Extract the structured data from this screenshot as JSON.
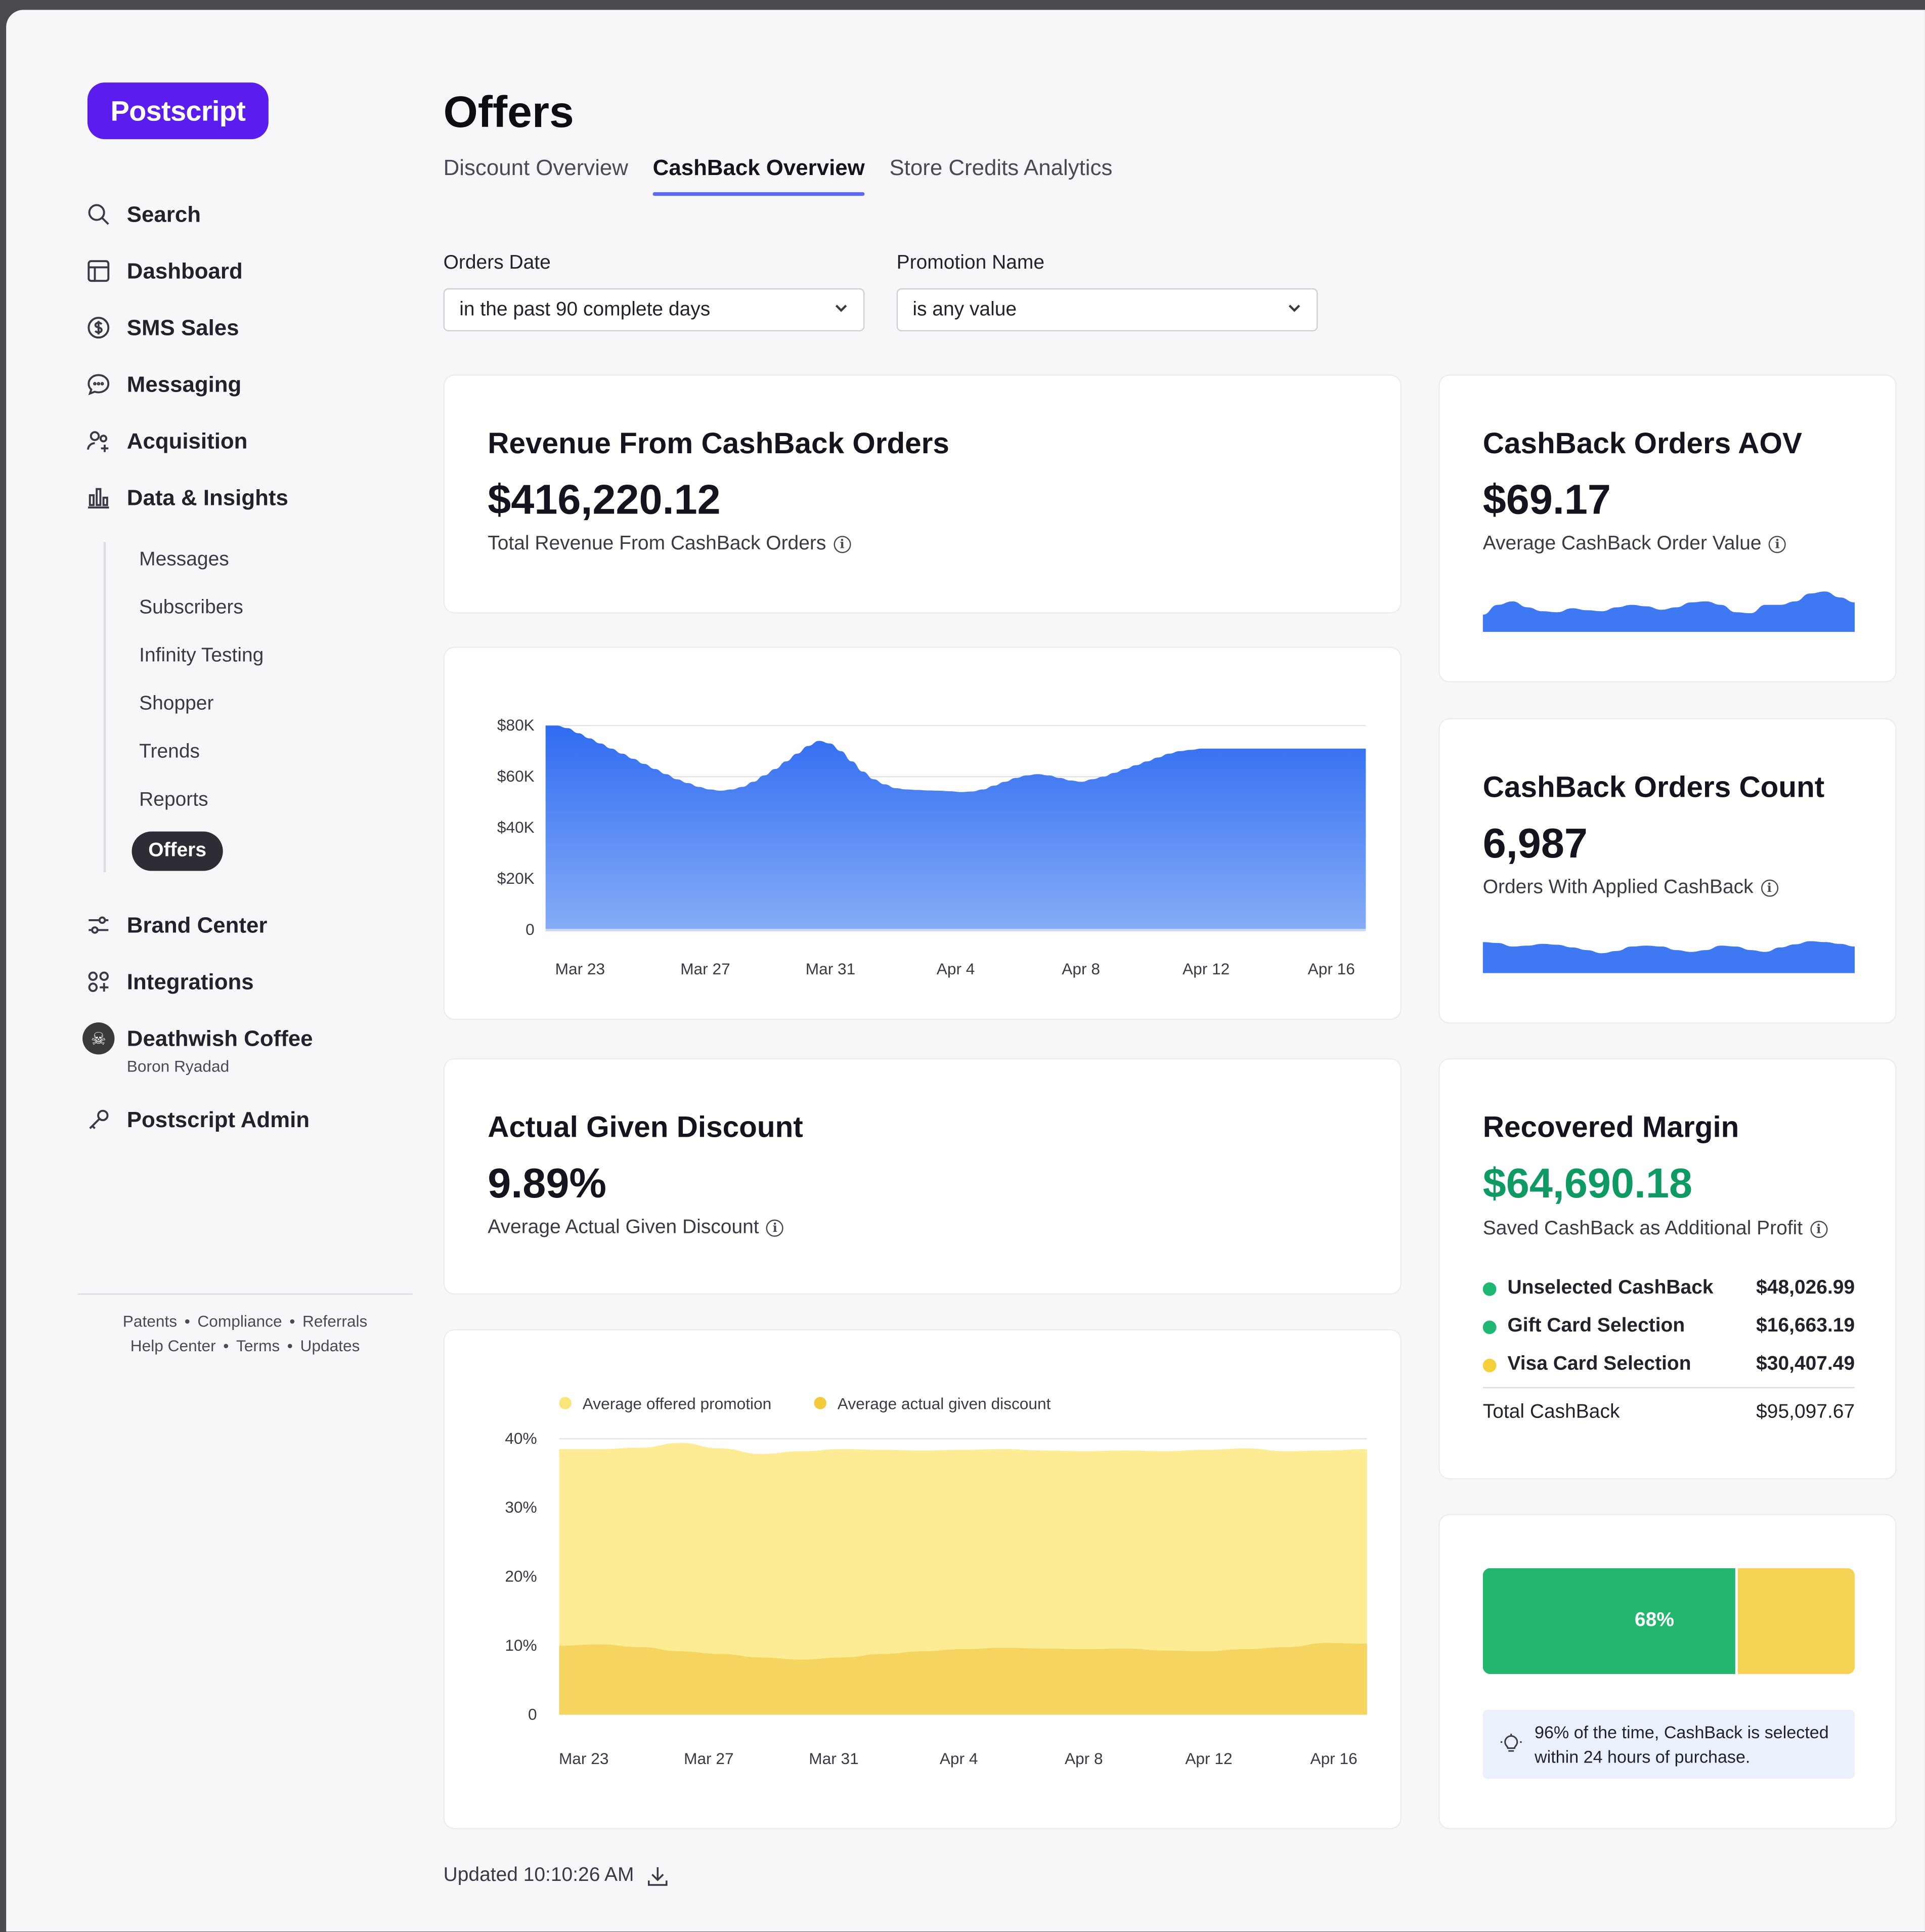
{
  "brand": {
    "logo_text": "Postscript",
    "logo_color": "#5b1ded"
  },
  "sidebar": {
    "items": [
      {
        "label": "Search",
        "icon": "search-icon"
      },
      {
        "label": "Dashboard",
        "icon": "layout-icon"
      },
      {
        "label": "SMS Sales",
        "icon": "dollar-circle-icon"
      },
      {
        "label": "Messaging",
        "icon": "chat-bubble-icon"
      },
      {
        "label": "Acquisition",
        "icon": "users-plus-icon"
      },
      {
        "label": "Data & Insights",
        "icon": "bar-chart-icon"
      }
    ],
    "sub_items": [
      "Messages",
      "Subscribers",
      "Infinity Testing",
      "Shopper",
      "Trends",
      "Reports",
      "Offers"
    ],
    "lower_items": [
      {
        "label": "Brand Center",
        "icon": "sliders-icon"
      },
      {
        "label": "Integrations",
        "icon": "grid-plus-icon"
      }
    ],
    "store": {
      "name": "Deathwish Coffee",
      "user": "Boron Ryadad",
      "icon": "skull-avatar-icon"
    },
    "admin": {
      "label": "Postscript Admin",
      "icon": "key-icon"
    },
    "footer": {
      "row1": [
        "Patents",
        "Compliance",
        "Referrals"
      ],
      "row2": [
        "Help Center",
        "Terms",
        "Updates"
      ],
      "separator": "•"
    }
  },
  "header": {
    "title": "Offers",
    "tabs": [
      "Discount Overview",
      "CashBack Overview",
      "Store Credits Analytics"
    ],
    "active_tab": "CashBack Overview"
  },
  "filters": {
    "orders_date": {
      "label": "Orders Date",
      "value": "in the past 90 complete days"
    },
    "promotion_name": {
      "label": "Promotion Name",
      "value": "is any value"
    }
  },
  "revenue_card": {
    "title": "Revenue From CashBack Orders",
    "value": "$416,220.12",
    "subtitle": "Total Revenue From CashBack Orders"
  },
  "aov_card": {
    "title": "CashBack Orders AOV",
    "value": "$69.17",
    "subtitle": "Average CashBack Order Value"
  },
  "count_card": {
    "title": "CashBack Orders Count",
    "value": "6,987",
    "subtitle": "Orders With Applied CashBack"
  },
  "discount_card": {
    "title": "Actual Given Discount",
    "value": "9.89%",
    "subtitle": "Average Actual Given Discount"
  },
  "margin_card": {
    "title": "Recovered Margin",
    "value": "$64,690.18",
    "value_color": "#0f9a63",
    "subtitle": "Saved CashBack as Additional Profit",
    "rows": [
      {
        "label": "Unselected CashBack",
        "amount": "$48,026.99",
        "color": "#1fb873"
      },
      {
        "label": "Gift Card Selection",
        "amount": "$16,663.19",
        "color": "#1fb873"
      },
      {
        "label": "Visa Card Selection",
        "amount": "$30,407.49",
        "color": "#f5cf3c"
      }
    ],
    "total_label": "Total CashBack",
    "total_amount": "$95,097.67"
  },
  "selection_card": {
    "percent_label": "68%",
    "percent": 68,
    "colors": {
      "primary": "#22b66e",
      "secondary": "#f7d355"
    },
    "tip": "96% of the time, CashBack is selected within 24 hours of purchase.",
    "tip_icon": "lightbulb-icon"
  },
  "revenue_chart": {
    "type": "area",
    "x_ticks": [
      "Mar 23",
      "Mar 27",
      "Mar 31",
      "Apr 4",
      "Apr 8",
      "Apr 12",
      "Apr 16"
    ],
    "y_ticks": [
      "$80K",
      "$60K",
      "$40K",
      "$20K",
      "0"
    ],
    "ylim": [
      0,
      80000
    ],
    "color": "#2f6cf2",
    "x": [
      0,
      3,
      6,
      9,
      12,
      15,
      18,
      21,
      24,
      27,
      30,
      33,
      36,
      39,
      42,
      45,
      48,
      51,
      54,
      57,
      60,
      63,
      66,
      69,
      72,
      75,
      78,
      81,
      84,
      87,
      90,
      93,
      96,
      99,
      102,
      105,
      108,
      111,
      114,
      117,
      120,
      123,
      126,
      129,
      132,
      135,
      138,
      141,
      144,
      147,
      150,
      153,
      156,
      159,
      162,
      165,
      168,
      171,
      174,
      177,
      180,
      183,
      186,
      189,
      192,
      195,
      198,
      201,
      204,
      207,
      210,
      213,
      216,
      219,
      222,
      225
    ],
    "values": [
      80000,
      80000,
      79000,
      77000,
      75000,
      73000,
      71000,
      69000,
      67000,
      65000,
      63000,
      61000,
      59000,
      57500,
      56000,
      55000,
      54500,
      55000,
      56000,
      58000,
      60500,
      63000,
      66000,
      69000,
      72000,
      74000,
      73000,
      70000,
      66000,
      62000,
      59000,
      57000,
      55500,
      55000,
      54800,
      54600,
      54500,
      54300,
      54000,
      54200,
      55000,
      56500,
      58000,
      59500,
      60500,
      61000,
      60500,
      59500,
      58500,
      58000,
      59000,
      60000,
      61500,
      63000,
      64500,
      66000,
      67500,
      69000,
      70000,
      70500,
      71000,
      71000,
      71000,
      71000,
      71000,
      71000,
      71000,
      71000,
      71000,
      71000,
      71000,
      71000,
      71000,
      71000,
      71000,
      71000
    ]
  },
  "aov_sparkline": {
    "type": "area",
    "values": [
      0.35,
      0.55,
      0.62,
      0.5,
      0.42,
      0.4,
      0.48,
      0.44,
      0.42,
      0.5,
      0.55,
      0.52,
      0.45,
      0.5,
      0.6,
      0.62,
      0.55,
      0.4,
      0.38,
      0.55,
      0.55,
      0.62,
      0.78,
      0.82,
      0.7,
      0.6
    ],
    "color": "#3e78f2"
  },
  "count_sparkline": {
    "type": "area",
    "values": [
      0.7,
      0.68,
      0.6,
      0.62,
      0.66,
      0.64,
      0.58,
      0.52,
      0.45,
      0.5,
      0.6,
      0.62,
      0.6,
      0.52,
      0.48,
      0.52,
      0.62,
      0.6,
      0.52,
      0.48,
      0.58,
      0.65,
      0.72,
      0.7,
      0.66,
      0.6
    ],
    "color": "#3e78f2"
  },
  "discount_chart": {
    "type": "area",
    "legend": [
      {
        "name": "Average offered promotion",
        "color": "#f9e57a"
      },
      {
        "name": "Average actual given discount",
        "color": "#f4c93a"
      }
    ],
    "x_ticks": [
      "Mar 23",
      "Mar 27",
      "Mar 31",
      "Apr 4",
      "Apr 8",
      "Apr 12",
      "Apr 16"
    ],
    "y_ticks": [
      "40%",
      "30%",
      "20%",
      "10%",
      "0"
    ],
    "ylim": [
      0,
      40
    ],
    "series": [
      {
        "name": "Average offered promotion",
        "values": [
          38.5,
          38.5,
          38.7,
          39.4,
          38.6,
          37.8,
          38.2,
          38.5,
          38.4,
          38.3,
          38.4,
          38.5,
          38.3,
          38.2,
          38.3,
          38.2,
          38.4,
          38.6,
          38.2,
          38.3,
          38.5
        ]
      },
      {
        "name": "Average actual given discount",
        "values": [
          10.0,
          10.2,
          9.8,
          9.2,
          8.8,
          8.3,
          8.0,
          8.3,
          8.8,
          9.2,
          9.5,
          9.7,
          9.6,
          9.5,
          9.6,
          9.3,
          9.2,
          9.5,
          9.8,
          10.4,
          10.3
        ]
      }
    ]
  },
  "updated": {
    "label": "Updated 10:10:26 AM",
    "icon": "download-icon"
  }
}
